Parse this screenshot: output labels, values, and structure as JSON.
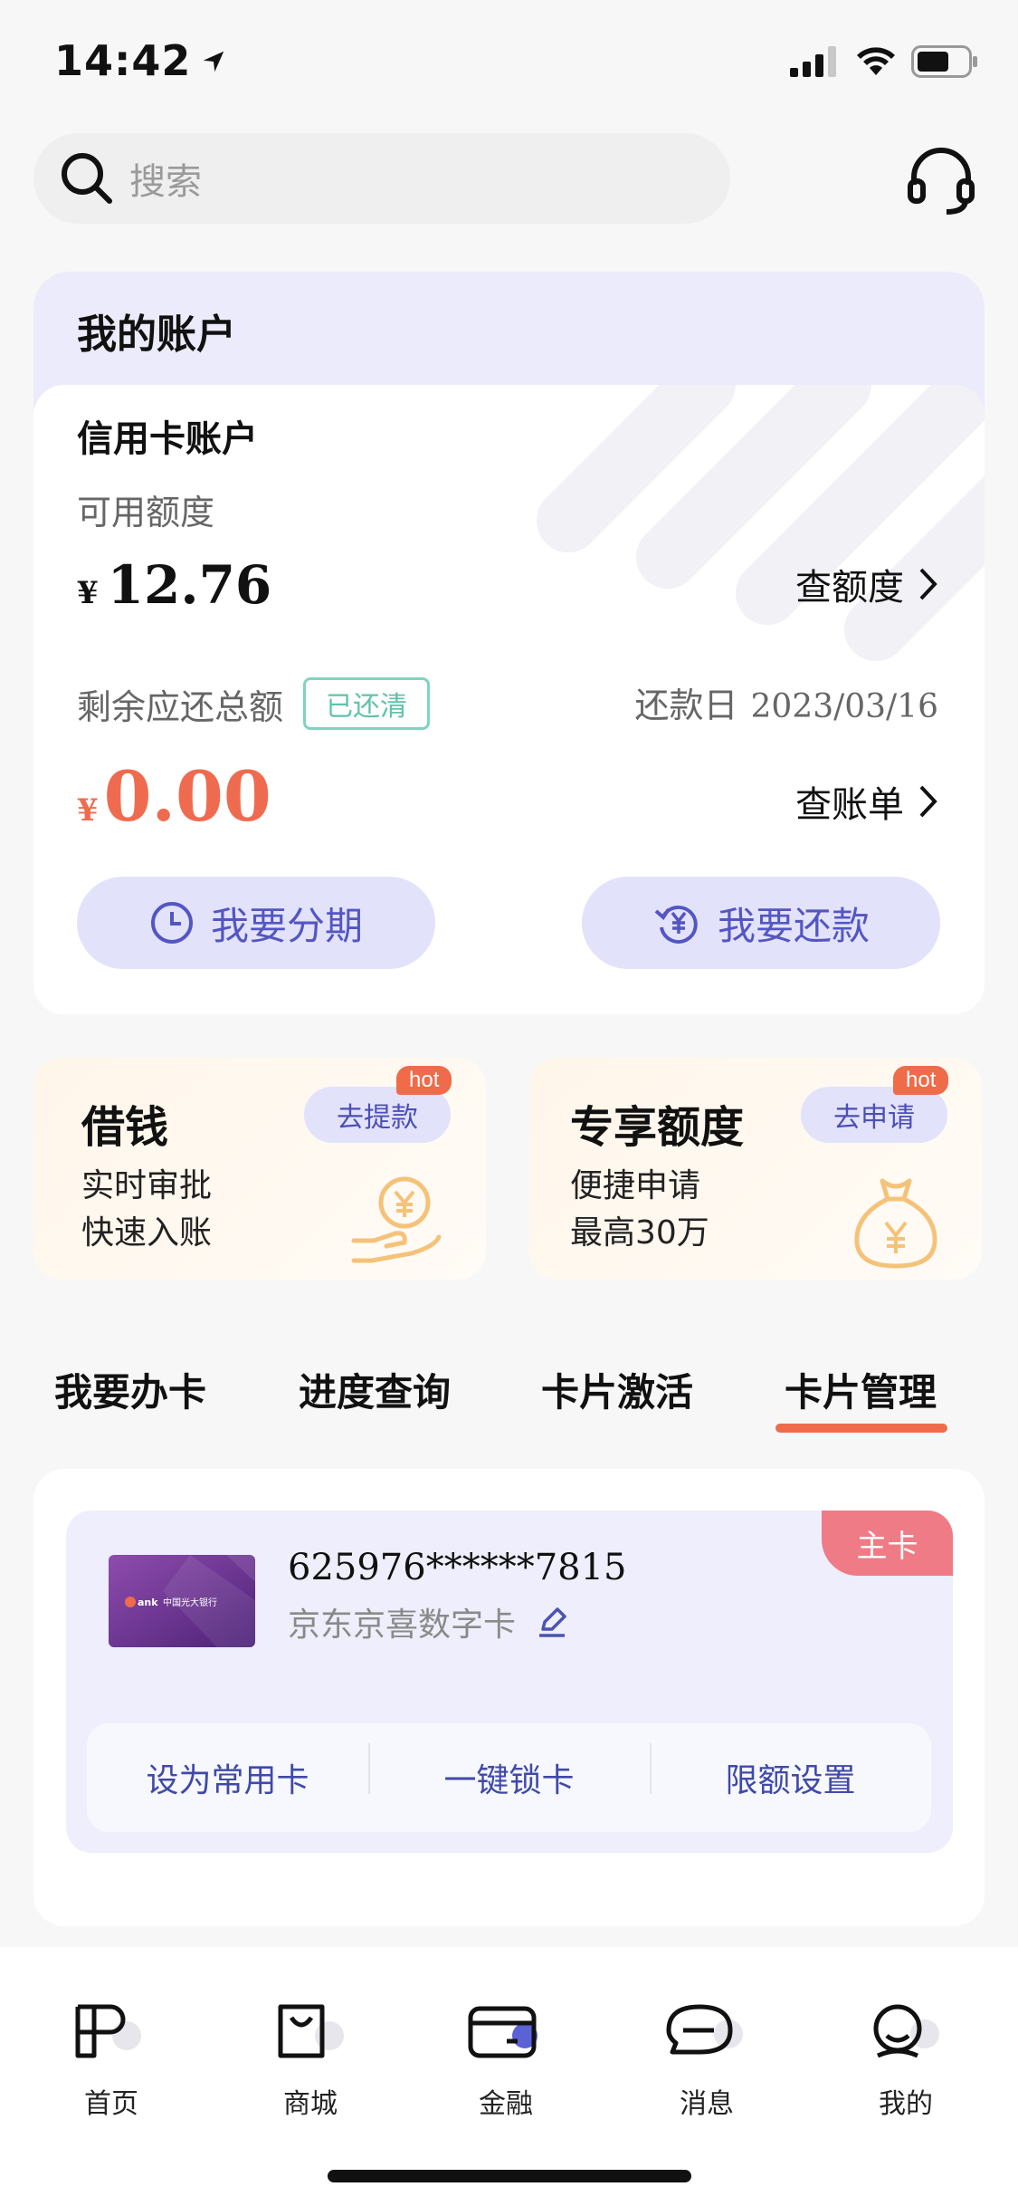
{
  "status_bar": {
    "time": "14:42"
  },
  "search": {
    "placeholder": "搜索"
  },
  "account": {
    "title": "我的账户",
    "credit_title": "信用卡账户",
    "available_label": "可用额度",
    "currency": "¥",
    "available_amount": "12.76",
    "check_limit": "查额度",
    "remaining_label": "剩余应还总额",
    "paid_badge": "已还清",
    "due_label": "还款日",
    "due_date": "2023/03/16",
    "remaining_amount": "0.00",
    "check_bill": "查账单",
    "installment_btn": "我要分期",
    "repay_btn": "我要还款"
  },
  "promos": [
    {
      "title": "借钱",
      "btn": "去提款",
      "tag": "hot",
      "lines": [
        "实时审批",
        "快速入账"
      ]
    },
    {
      "title": "专享额度",
      "btn": "去申请",
      "tag": "hot",
      "lines": [
        "便捷申请",
        "最高30万"
      ]
    }
  ],
  "tabs": [
    "我要办卡",
    "进度查询",
    "卡片激活",
    "卡片管理"
  ],
  "active_tab": "卡片管理",
  "card": {
    "number": "625976******7815",
    "name": "京东京喜数字卡",
    "main_tag": "主卡",
    "thumb_text": "中国光大银行",
    "actions": [
      "设为常用卡",
      "一键锁卡",
      "限额设置"
    ]
  },
  "bottom_nav": [
    "首页",
    "商城",
    "金融",
    "消息",
    "我的"
  ],
  "colors": {
    "accent": "#ef6b4a",
    "primary_purple": "#5356c2",
    "pill_bg": "#e3e2fb",
    "paid_green": "#61c2aa",
    "main_tag": "#ef7b86"
  }
}
